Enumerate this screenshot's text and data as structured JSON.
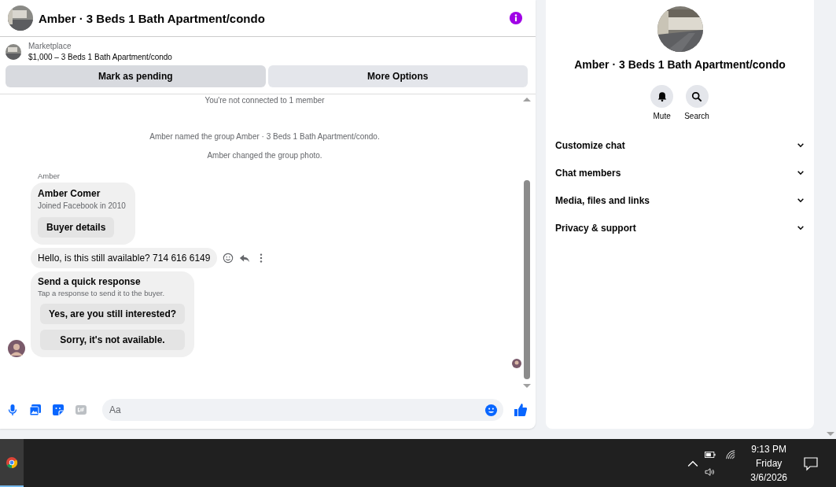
{
  "header": {
    "title": "Amber · 3 Beds 1 Bath Apartment/condo"
  },
  "listing": {
    "label": "Marketplace",
    "title": "$1,000 – 3 Beds 1 Bath Apartment/condo"
  },
  "actions": [
    "Mark as pending",
    "More Options"
  ],
  "chat": {
    "notices": [
      "You're not connected to 1 member",
      "Amber named the group Amber · 3 Beds 1 Bath Apartment/condo.",
      "Amber changed the group photo."
    ],
    "sender": "Amber",
    "profile_card": {
      "name": "Amber Comer",
      "subtitle": "Joined Facebook in 2010",
      "button": "Buyer details"
    },
    "message": "Hello, is this still available? 714 616 6149",
    "quick_response": {
      "title": "Send a quick response",
      "subtitle": "Tap a response to send it to the buyer.",
      "options": [
        "Yes, are you still interested?",
        "Sorry, it's not available."
      ]
    }
  },
  "composer": {
    "placeholder": "Aa"
  },
  "details": {
    "title": "Amber · 3 Beds 1 Bath Apartment/condo",
    "actions": [
      {
        "kind": "mute",
        "label": "Mute"
      },
      {
        "kind": "search",
        "label": "Search"
      }
    ],
    "sections": [
      {
        "label": "Customize chat",
        "expanded": false
      },
      {
        "label": "Chat members",
        "expanded": false
      },
      {
        "label": "Media, files and links",
        "expanded": false
      },
      {
        "label": "Privacy & support",
        "expanded": false
      }
    ]
  },
  "taskbar": {
    "time": "9:13 PM",
    "day": "Friday",
    "date": "3/6/2026"
  }
}
